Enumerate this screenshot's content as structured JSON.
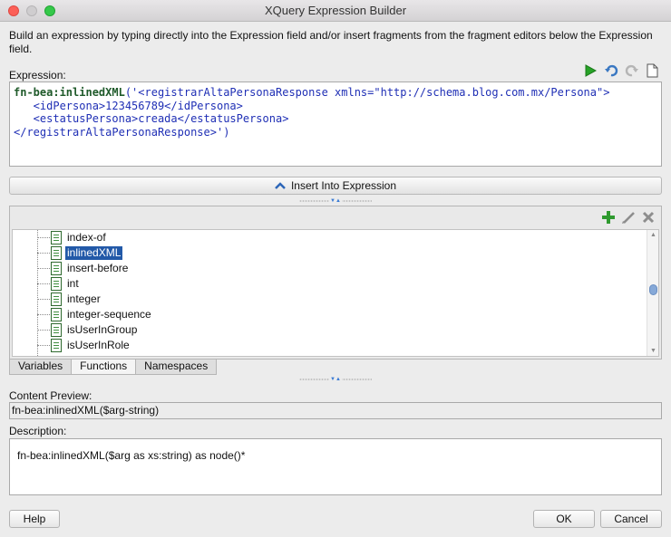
{
  "window": {
    "title": "XQuery Expression Builder"
  },
  "intro_text": "Build an expression by typing directly into the Expression field and/or insert fragments from the fragment editors below the Expression field.",
  "expression": {
    "label": "Expression:",
    "toolbar": [
      "run-icon",
      "undo-icon",
      "redo-icon",
      "new-document-icon"
    ],
    "lines": [
      {
        "fn": "fn-bea:inlinedXML",
        "rest": "('<registrarAltaPersonaResponse xmlns=\"http://schema.blog.com.mx/Persona\">"
      },
      {
        "fn": "",
        "rest": "   <idPersona>123456789</idPersona>"
      },
      {
        "fn": "",
        "rest": "   <estatusPersona>creada</estatusPersona>"
      },
      {
        "fn": "",
        "rest": "</registrarAltaPersonaResponse>')"
      }
    ]
  },
  "insert_button": {
    "label": "Insert Into Expression"
  },
  "fragment_toolbar": [
    "add-icon",
    "edit-icon",
    "delete-icon"
  ],
  "functions_list": {
    "items": [
      "index-of",
      "inlinedXML",
      "insert-before",
      "int",
      "integer",
      "integer-sequence",
      "isUserInGroup",
      "isUserInRole"
    ],
    "selected": "inlinedXML"
  },
  "tabs": [
    "Variables",
    "Functions",
    "Namespaces"
  ],
  "active_tab": "Functions",
  "content_preview": {
    "label": "Content Preview:",
    "value": "fn-bea:inlinedXML($arg-string)"
  },
  "description": {
    "label": "Description:",
    "value": "fn-bea:inlinedXML($arg as xs:string) as node()*"
  },
  "buttons": {
    "help": "Help",
    "ok": "OK",
    "cancel": "Cancel"
  },
  "colors": {
    "selection": "#2259a8",
    "function_keyword": "#1f5a2a",
    "string_literal": "#1f2fb5"
  }
}
